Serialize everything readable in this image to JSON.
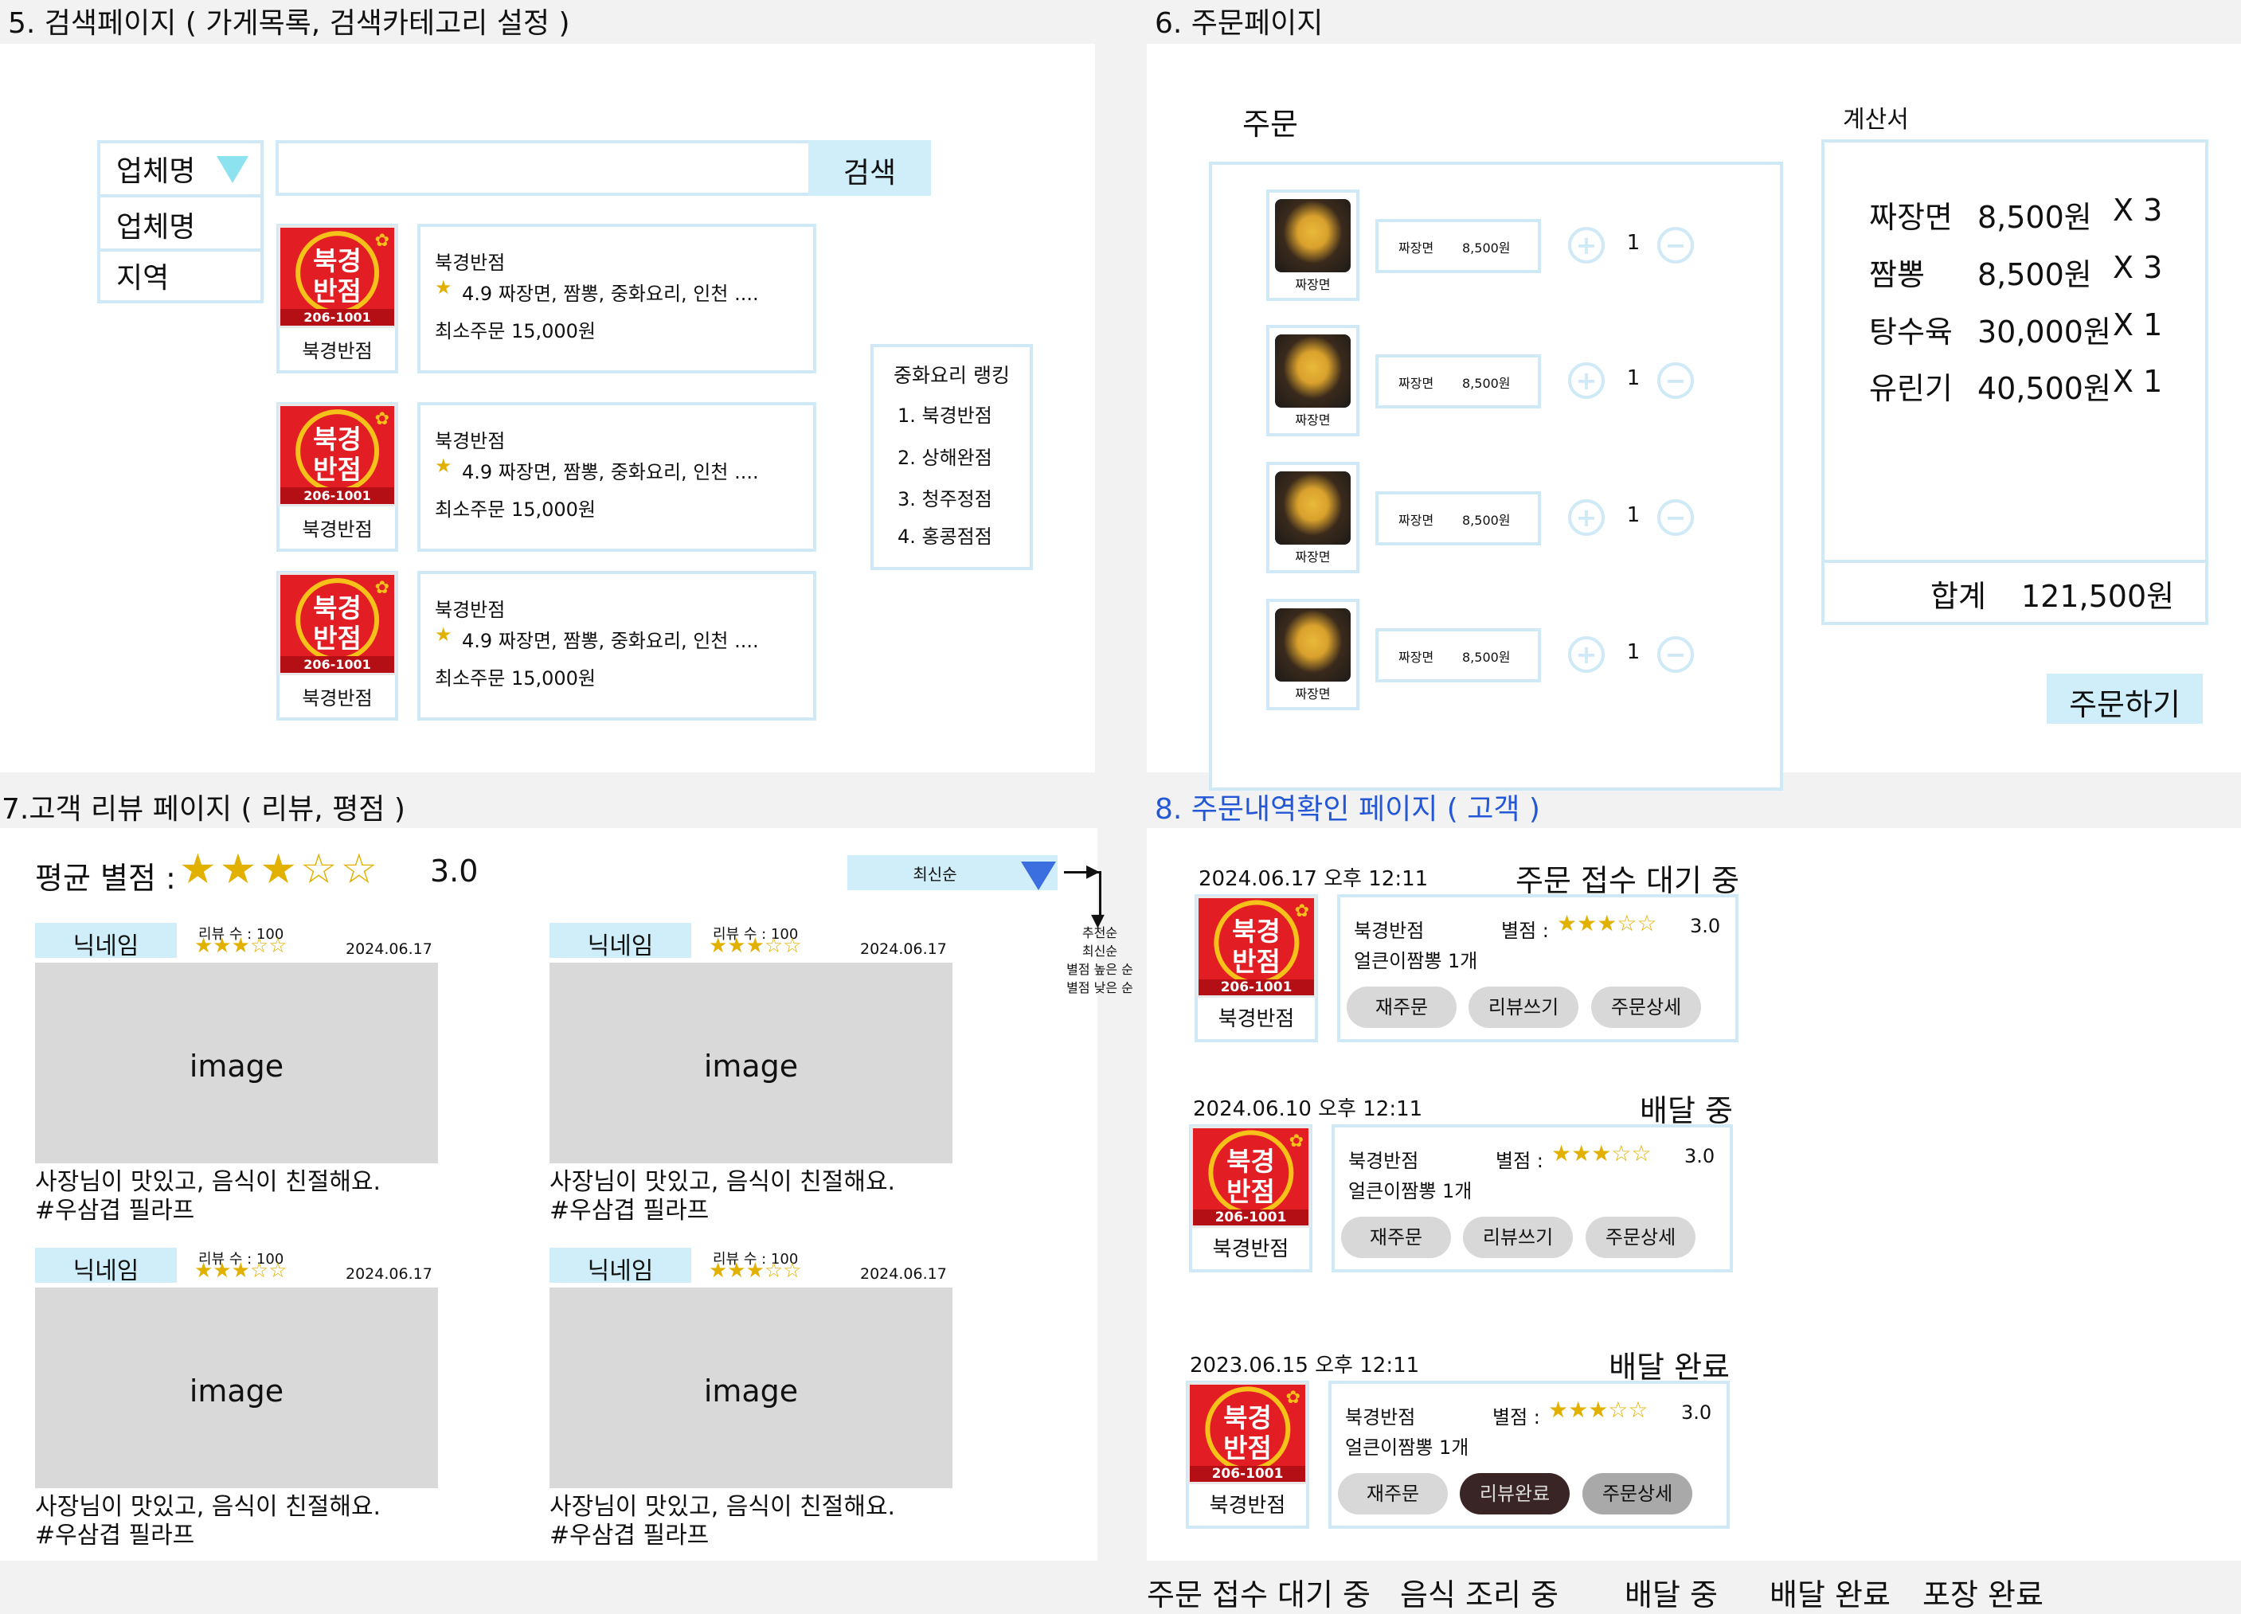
{
  "sec5": {
    "title": "5. 검색페이지 ( 가게목록, 검색카테고리 설정 )",
    "dropdown_selected": "업체명",
    "dropdown_options": [
      "업체명",
      "지역"
    ],
    "search_button": "검색",
    "stores": [
      {
        "logo_line1": "북경",
        "logo_line2": "반점",
        "logo_num": "206-1001",
        "caption": "북경반점",
        "name": "북경반점",
        "rating_line": "4.9 짜장면, 짬뽕, 중화요리, 인천 ....",
        "min_order": "최소주문 15,000원"
      },
      {
        "logo_line1": "북경",
        "logo_line2": "반점",
        "logo_num": "206-1001",
        "caption": "북경반점",
        "name": "북경반점",
        "rating_line": "4.9 짜장면, 짬뽕, 중화요리, 인천 ....",
        "min_order": "최소주문 15,000원"
      },
      {
        "logo_line1": "북경",
        "logo_line2": "반점",
        "logo_num": "206-1001",
        "caption": "북경반점",
        "name": "북경반점",
        "rating_line": "4.9 짜장면, 짬뽕, 중화요리, 인천 ....",
        "min_order": "최소주문 15,000원"
      }
    ],
    "ranking": {
      "title": "중화요리 랭킹",
      "items": [
        "1. 북경반점",
        "2. 상해완점",
        "3. 청주정점",
        "4. 홍콩점점"
      ]
    }
  },
  "sec6": {
    "title": "6. 주문페이지",
    "order_label": "주문",
    "items": [
      {
        "caption": "짜장면",
        "name": "짜장면",
        "price": "8,500원",
        "qty": "1"
      },
      {
        "caption": "짜장면",
        "name": "짜장면",
        "price": "8,500원",
        "qty": "1"
      },
      {
        "caption": "짜장면",
        "name": "짜장면",
        "price": "8,500원",
        "qty": "1"
      },
      {
        "caption": "짜장면",
        "name": "짜장면",
        "price": "8,500원",
        "qty": "1"
      }
    ],
    "receipt_label": "계산서",
    "receipt_lines": [
      {
        "name": "짜장면",
        "price": "8,500원",
        "qty": "X 3"
      },
      {
        "name": "짬뽕",
        "price": "8,500원",
        "qty": "X 3"
      },
      {
        "name": "탕수육",
        "price": "30,000원",
        "qty": "X 1"
      },
      {
        "name": "유린기",
        "price": "40,500원",
        "qty": "X 1"
      }
    ],
    "total_label": "합계",
    "total_value": "121,500원",
    "order_button": "주문하기"
  },
  "sec7": {
    "title": "7.고객 리뷰 페이지 ( 리뷰, 평점 )",
    "avg_label": "평균 별점 :",
    "avg_stars": "★★★☆☆",
    "avg_value": "3.0",
    "sort_selected": "최신순",
    "sort_options": [
      "추천순",
      "최신순",
      "별점 높은 순",
      "별점 낮은 순"
    ],
    "reviews": [
      {
        "nickname": "닉네임",
        "review_count": "리뷰 수 : 100",
        "stars": "★★★☆☆",
        "date": "2024.06.17",
        "image_label": "image",
        "text1": "사장님이 맛있고, 음식이 친절해요.",
        "text2": "#우삼겹 필라프"
      },
      {
        "nickname": "닉네임",
        "review_count": "리뷰 수 : 100",
        "stars": "★★★☆☆",
        "date": "2024.06.17",
        "image_label": "image",
        "text1": "사장님이 맛있고, 음식이 친절해요.",
        "text2": "#우삼겹 필라프"
      },
      {
        "nickname": "닉네임",
        "review_count": "리뷰 수 : 100",
        "stars": "★★★☆☆",
        "date": "2024.06.17",
        "image_label": "image",
        "text1": "사장님이 맛있고, 음식이 친절해요.",
        "text2": "#우삼겹 필라프"
      },
      {
        "nickname": "닉네임",
        "review_count": "리뷰 수 : 100",
        "stars": "★★★☆☆",
        "date": "2024.06.17",
        "image_label": "image",
        "text1": "사장님이 맛있고, 음식이 친절해요.",
        "text2": "#우삼겹 필라프"
      }
    ]
  },
  "sec8": {
    "title": "8. 주문내역확인 페이지 ( 고객 )",
    "title_color": "#2457d6",
    "orders": [
      {
        "datetime": "2024.06.17 오후 12:11",
        "status": "주문 접수 대기 중",
        "logo_line1": "북경",
        "logo_line2": "반점",
        "logo_num": "206-1001",
        "caption": "북경반점",
        "name": "북경반점",
        "rating_label": "별점 :",
        "stars": "★★★☆☆",
        "rating": "3.0",
        "menu": "얼큰이짬뽕 1개",
        "btn1": "재주문",
        "btn2": "리뷰쓰기",
        "btn3": "주문상세"
      },
      {
        "datetime": "2024.06.10 오후 12:11",
        "status": "배달 중",
        "logo_line1": "북경",
        "logo_line2": "반점",
        "logo_num": "206-1001",
        "caption": "북경반점",
        "name": "북경반점",
        "rating_label": "별점 :",
        "stars": "★★★☆☆",
        "rating": "3.0",
        "menu": "얼큰이짬뽕 1개",
        "btn1": "재주문",
        "btn2": "리뷰쓰기",
        "btn3": "주문상세"
      },
      {
        "datetime": "2023.06.15 오후 12:11",
        "status": "배달 완료",
        "logo_line1": "북경",
        "logo_line2": "반점",
        "logo_num": "206-1001",
        "caption": "북경반점",
        "name": "북경반점",
        "rating_label": "별점 :",
        "stars": "★★★☆☆",
        "rating": "3.0",
        "menu": "얼큰이짬뽕 1개",
        "btn1": "재주문",
        "btn2": "리뷰완료",
        "btn3": "주문상세"
      }
    ],
    "status_legend": [
      "주문 접수 대기 중",
      "음식 조리 중",
      "배달 중",
      "배달 완료",
      "포장 완료"
    ]
  }
}
